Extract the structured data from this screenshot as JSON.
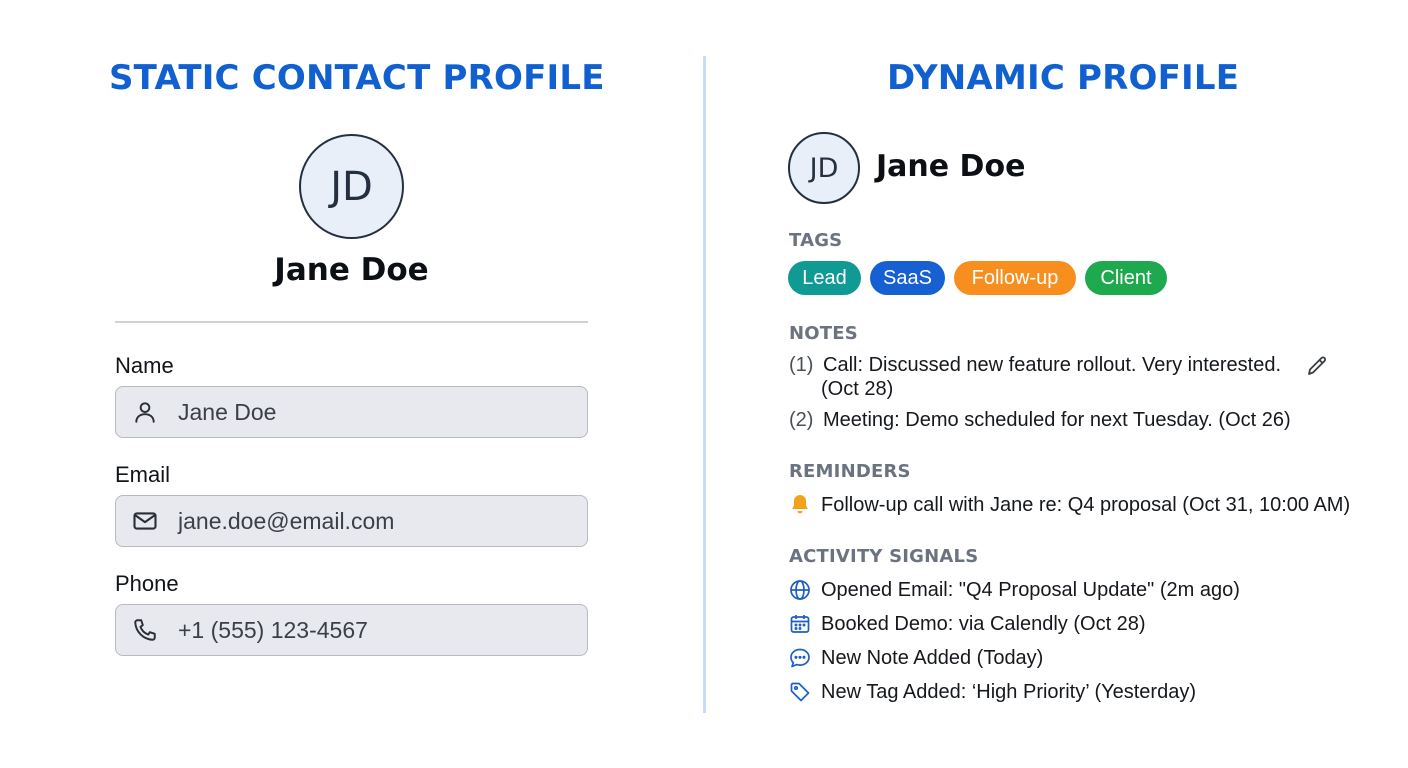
{
  "left": {
    "heading": "STATIC CONTACT PROFILE",
    "avatar_initials": "JD",
    "name": "Jane Doe",
    "fields": [
      {
        "label": "Name",
        "value": "Jane Doe",
        "icon": "user-icon"
      },
      {
        "label": "Email",
        "value": "jane.doe@email.com",
        "icon": "mail-icon"
      },
      {
        "label": "Phone",
        "value": "+1 (555) 123-4567",
        "icon": "phone-icon"
      }
    ]
  },
  "right": {
    "heading": "DYNAMIC PROFILE",
    "avatar_initials": "JD",
    "name": "Jane Doe",
    "tags_title": "TAGS",
    "tags": [
      {
        "label": "Lead",
        "color": "#0f9a94"
      },
      {
        "label": "SaaS",
        "color": "#1660d2"
      },
      {
        "label": "Follow-up",
        "color": "#f78f1e"
      },
      {
        "label": "Client",
        "color": "#1fa94f"
      }
    ],
    "notes_title": "NOTES",
    "notes": [
      {
        "num": "(1)",
        "line1": "Call: Discussed new feature rollout. Very interested.",
        "line2": "(Oct 28)"
      },
      {
        "num": "(2)",
        "line1": "Meeting: Demo scheduled for next Tuesday. (Oct 26)"
      }
    ],
    "reminders_title": "REMINDERS",
    "reminders": [
      {
        "icon": "bell-icon",
        "text": "Follow-up call with Jane re: Q4 proposal (Oct 31, 10:00 AM)"
      }
    ],
    "activity_title": "ACTIVITY SIGNALS",
    "activity": [
      {
        "icon": "globe-icon",
        "text": "Opened Email: \"Q4 Proposal Update\" (2m ago)"
      },
      {
        "icon": "calendar-icon",
        "text": "Booked Demo: via Calendly (Oct 28)"
      },
      {
        "icon": "chat-bubble-icon",
        "text": "New Note Added (Today)"
      },
      {
        "icon": "tag-icon",
        "text": "New Tag Added: ‘High Priority’ (Yesterday)"
      }
    ]
  },
  "colors": {
    "heading": "#1160d0",
    "icon_blue": "#1f5fbf",
    "bell": "#f5a21b"
  }
}
